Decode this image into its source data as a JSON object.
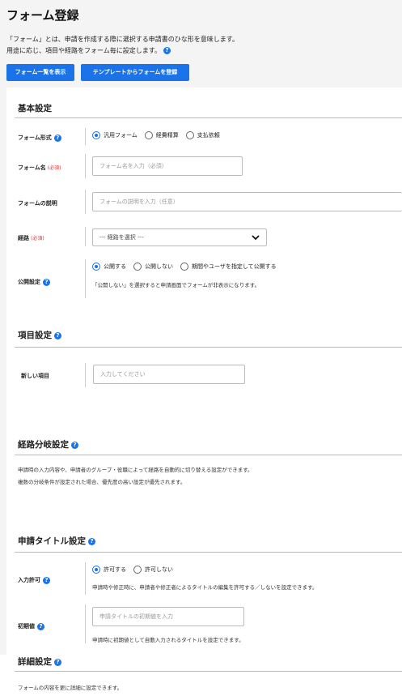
{
  "page": {
    "title": "フォーム登録"
  },
  "intro": {
    "line1": "「フォーム」とは、申請を作成する際に選択する申請書のひな形を意味します。",
    "line2": "用途に応じ、項目や経路をフォーム毎に設定します。"
  },
  "buttons": {
    "list": "フォーム一覧を表示",
    "template": "テンプレートからフォームを登録"
  },
  "basic": {
    "title": "基本設定",
    "form_type": {
      "label": "フォーム形式",
      "options": [
        "汎用フォーム",
        "経費精算",
        "支払依頼"
      ],
      "selected": "汎用フォーム"
    },
    "form_name": {
      "label": "フォーム名",
      "required": "(必須)",
      "placeholder": "フォーム名を入力（必須）"
    },
    "form_desc": {
      "label": "フォームの説明",
      "placeholder": "フォームの説明を入力（任意）"
    },
    "route": {
      "label": "経路",
      "required": "(必須)",
      "value": "--- 経路を選択 ---"
    },
    "publish": {
      "label": "公開設定",
      "options": [
        "公開する",
        "公開しない",
        "期間やユーザを指定して公開する"
      ],
      "selected": "公開する",
      "note": "「公開しない」を選択すると申請画面でフォームが非表示になります。"
    }
  },
  "items": {
    "title": "項目設定",
    "new_item": {
      "label": "新しい項目",
      "placeholder": "入力してください"
    }
  },
  "branch": {
    "title": "経路分岐設定",
    "note1": "申請時の入力内容や、申請者のグループ・役職によって経路を自動的に切り替える設定ができます。",
    "note2": "複数の分岐条件が設定された場合、優先度の高い設定が優先されます。"
  },
  "app_title": {
    "title": "申請タイトル設定",
    "input_permit": {
      "label": "入力許可",
      "options": [
        "許可する",
        "許可しない"
      ],
      "selected": "許可する",
      "note": "申請時や修正時に、申請者や修正者によるタイトルの編集を許可する／しないを設定できます。"
    },
    "initial": {
      "label": "初期値",
      "placeholder": "申請タイトルの初期値を入力",
      "note": "申請時に初期値として自動入力されるタイトルを設定できます。"
    }
  },
  "detail": {
    "title": "詳細設定",
    "note": "フォームの内容を更に詳細に設定できます。"
  },
  "colors": {
    "accent": "#1a73e8",
    "required": "#d33333"
  },
  "icons": [
    "help-icon",
    "chevron-down-icon"
  ]
}
